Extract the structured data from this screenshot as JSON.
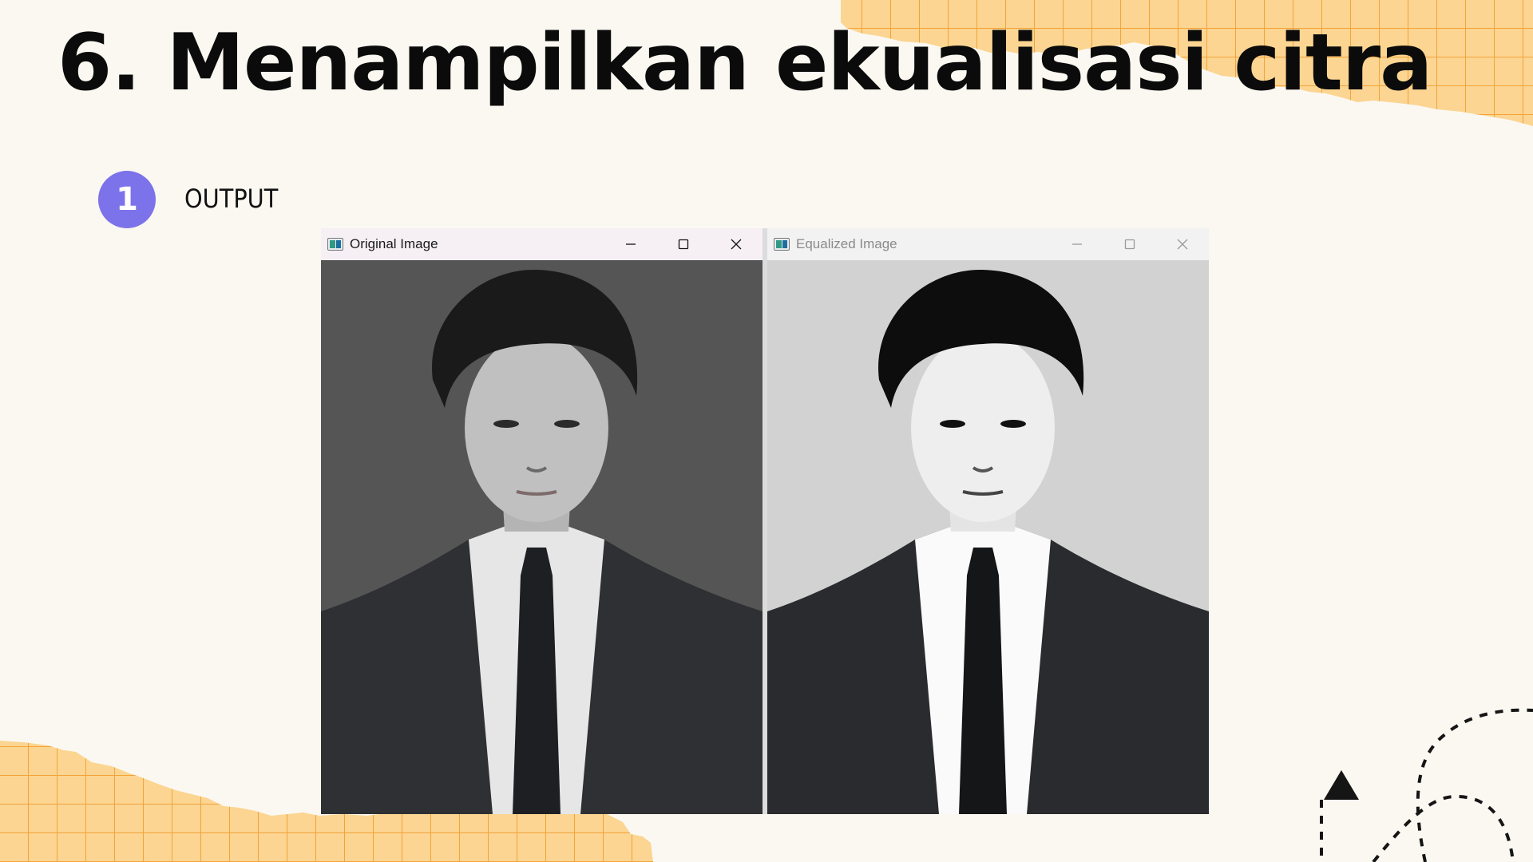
{
  "slide": {
    "title": "6. Menampilkan ekualisasi citra",
    "step_number": "1",
    "step_label": "OUTPUT"
  },
  "windows": [
    {
      "title": "Original Image",
      "icon": "image-window-icon",
      "active": true
    },
    {
      "title": "Equalized Image",
      "icon": "image-window-icon",
      "active": false
    }
  ],
  "colors": {
    "background": "#fbf8f1",
    "grid_paper": "#fbd591",
    "grid_lines": "#f3a33a",
    "badge": "#7c72ea",
    "original_bg": "#555555",
    "equalized_bg": "#d2d2d2"
  }
}
